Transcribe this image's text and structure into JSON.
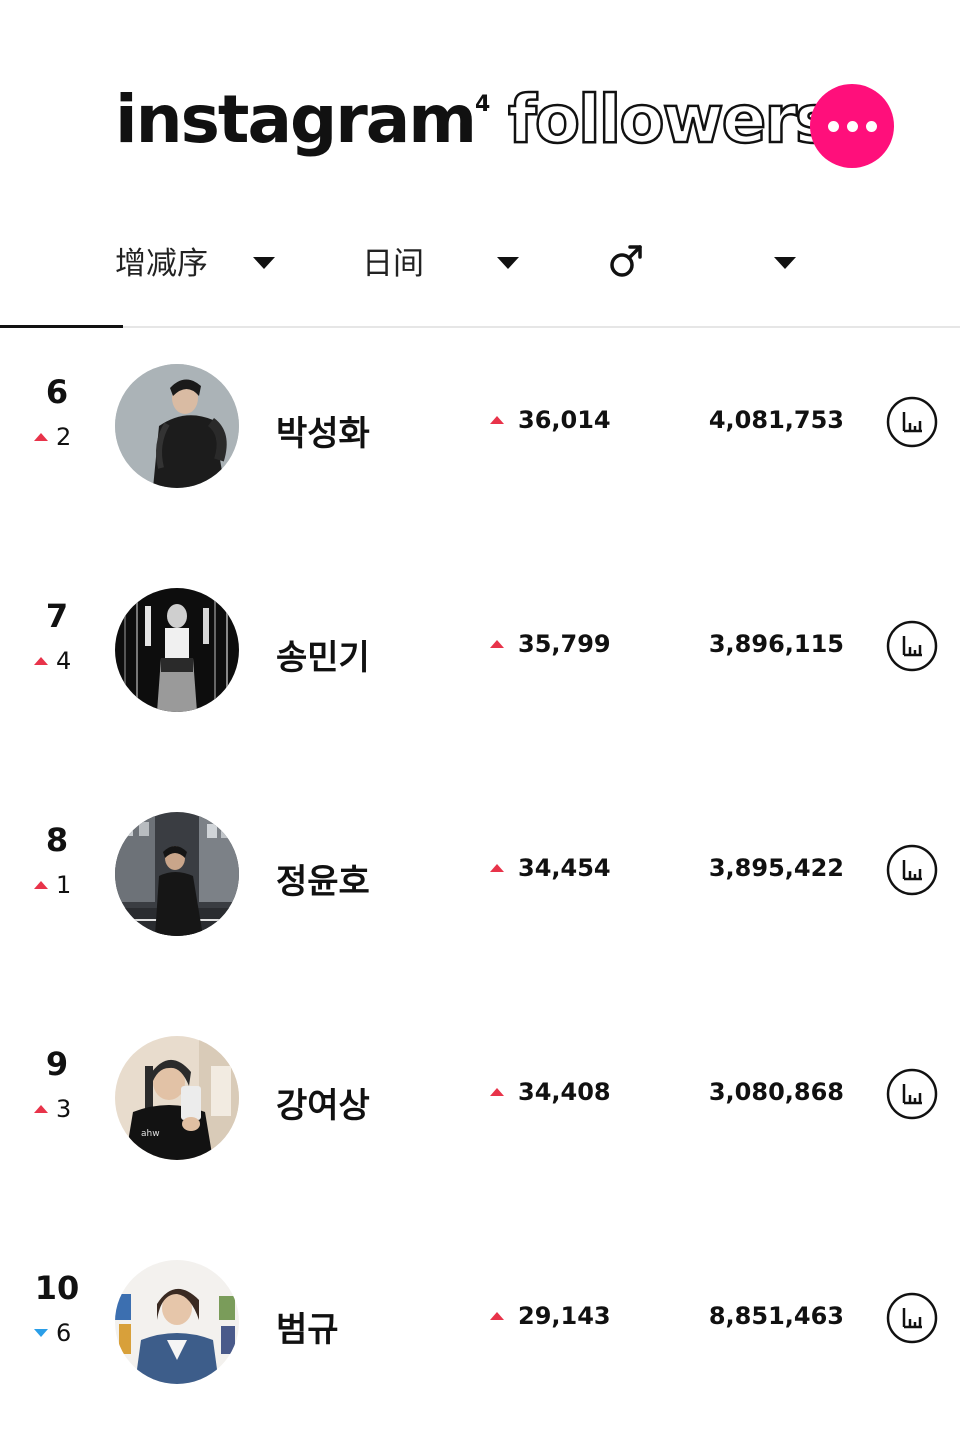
{
  "header": {
    "logo_word": "instagram",
    "logo_superscript": "4",
    "logo_outline_word": "followers",
    "more_button_color": "#ff0f7b"
  },
  "filters": {
    "sort_label": "增减序",
    "period_label": "日间",
    "gender_icon": "male-symbol-icon"
  },
  "rows": [
    {
      "rank": "6",
      "change_direction": "up",
      "change": "2",
      "name": "박성화",
      "delta": "36,014",
      "total": "4,081,753"
    },
    {
      "rank": "7",
      "change_direction": "up",
      "change": "4",
      "name": "송민기",
      "delta": "35,799",
      "total": "3,896,115"
    },
    {
      "rank": "8",
      "change_direction": "up",
      "change": "1",
      "name": "정윤호",
      "delta": "34,454",
      "total": "3,895,422"
    },
    {
      "rank": "9",
      "change_direction": "up",
      "change": "3",
      "name": "강여상",
      "delta": "34,408",
      "total": "3,080,868"
    },
    {
      "rank": "10",
      "change_direction": "down",
      "change": "6",
      "name": "범규",
      "delta": "29,143",
      "total": "8,851,463"
    }
  ],
  "colors": {
    "up": "#e8334a",
    "down": "#2a9ee8",
    "accent": "#ff0f7b"
  }
}
